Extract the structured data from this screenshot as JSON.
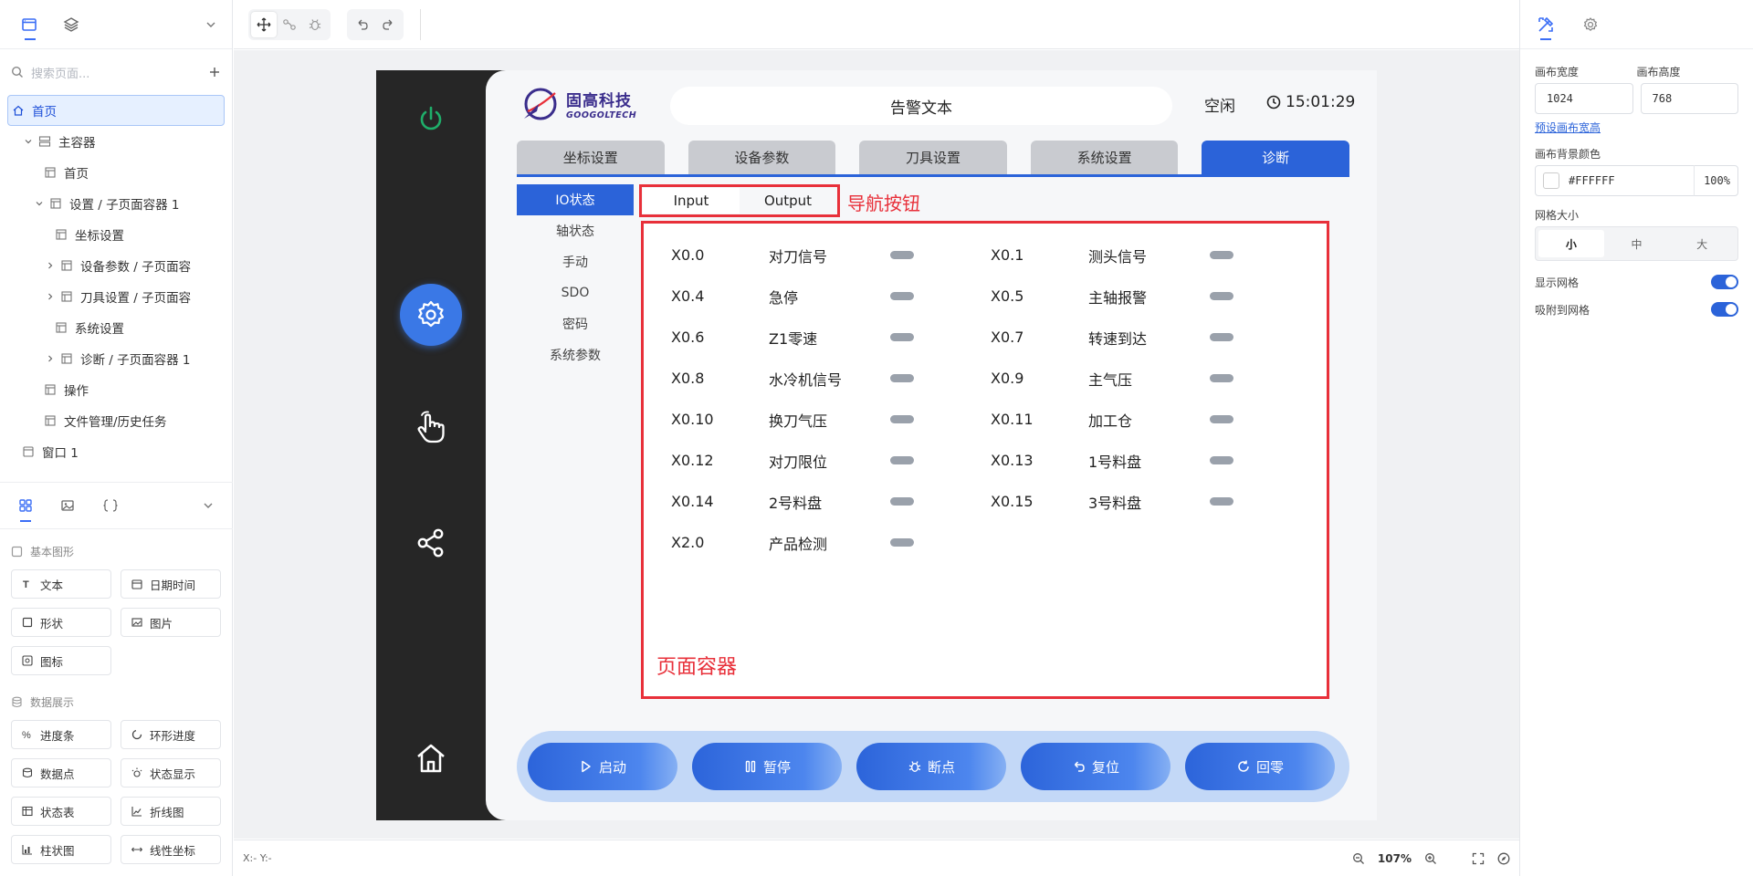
{
  "left_panel": {
    "search_placeholder": "搜索页面...",
    "tree": [
      {
        "label": "首页",
        "level": 0,
        "selected": true,
        "icon": "home-icon"
      },
      {
        "label": "主容器",
        "level": 1,
        "caret": "down",
        "icon": "container-icon"
      },
      {
        "label": "首页",
        "level": 2,
        "icon": "page-icon"
      },
      {
        "label": "设置 / 子页面容器 1",
        "level": 2,
        "caret": "down",
        "icon": "page-icon"
      },
      {
        "label": "坐标设置",
        "level": 3,
        "icon": "page-icon"
      },
      {
        "label": "设备参数 / 子页面容",
        "level": 3,
        "caret": "right",
        "icon": "page-icon"
      },
      {
        "label": "刀具设置 / 子页面容",
        "level": 3,
        "caret": "right",
        "icon": "page-icon"
      },
      {
        "label": "系统设置",
        "level": 3,
        "icon": "page-icon"
      },
      {
        "label": "诊断 / 子页面容器 1",
        "level": 3,
        "caret": "right",
        "icon": "page-icon"
      },
      {
        "label": "操作",
        "level": 2,
        "icon": "page-icon"
      },
      {
        "label": "文件管理/历史任务",
        "level": 2,
        "icon": "page-icon"
      },
      {
        "label": "窗口 1",
        "level": 0,
        "icon": "window-icon"
      }
    ],
    "basic_section": "基本图形",
    "basic_items": [
      "文本",
      "日期时间",
      "形状",
      "图片",
      "图标"
    ],
    "data_section": "数据展示",
    "data_items": [
      "进度条",
      "环形进度",
      "数据点",
      "状态显示",
      "状态表",
      "折线图",
      "柱状图",
      "线性坐标"
    ]
  },
  "statusbar": {
    "coords": "X:- Y:-",
    "zoom": "107%"
  },
  "hmi": {
    "logo_cn": "固高科技",
    "logo_en": "GOOGOLTECH",
    "alarm_text": "告警文本",
    "state": "空闲",
    "time": "15:01:29",
    "tabs": [
      "坐标设置",
      "设备参数",
      "刀具设置",
      "系统设置",
      "诊断"
    ],
    "active_tab": 4,
    "subnav": [
      "IO状态",
      "轴状态",
      "手动",
      "SDO",
      "密码",
      "系统参数"
    ],
    "nav_buttons": [
      "Input",
      "Output"
    ],
    "nav_annotation": "导航按钮",
    "container_annotation": "页面容器",
    "io_rows": [
      [
        {
          "addr": "X0.0",
          "name": "对刀信号"
        },
        {
          "addr": "X0.1",
          "name": "测头信号"
        }
      ],
      [
        {
          "addr": "X0.4",
          "name": "急停"
        },
        {
          "addr": "X0.5",
          "name": "主轴报警"
        }
      ],
      [
        {
          "addr": "X0.6",
          "name": "Z1零速"
        },
        {
          "addr": "X0.7",
          "name": "转速到达"
        }
      ],
      [
        {
          "addr": "X0.8",
          "name": "水冷机信号"
        },
        {
          "addr": "X0.9",
          "name": "主气压"
        }
      ],
      [
        {
          "addr": "X0.10",
          "name": "换刀气压"
        },
        {
          "addr": "X0.11",
          "name": "加工仓"
        }
      ],
      [
        {
          "addr": "X0.12",
          "name": "对刀限位"
        },
        {
          "addr": "X0.13",
          "name": "1号料盘"
        }
      ],
      [
        {
          "addr": "X0.14",
          "name": "2号料盘"
        },
        {
          "addr": "X0.15",
          "name": "3号料盘"
        }
      ],
      [
        {
          "addr": "X2.0",
          "name": "产品检测"
        }
      ]
    ],
    "actions": [
      {
        "label": "启动",
        "icon": "play-icon"
      },
      {
        "label": "暂停",
        "icon": "pause-icon"
      },
      {
        "label": "断点",
        "icon": "bug-icon"
      },
      {
        "label": "复位",
        "icon": "undo-icon"
      },
      {
        "label": "回零",
        "icon": "refresh-icon"
      }
    ]
  },
  "right_panel": {
    "width_label": "画布宽度",
    "height_label": "画布高度",
    "width_value": "1024",
    "height_value": "768",
    "preset_link": "预设画布宽高",
    "bg_label": "画布背景颜色",
    "bg_color": "#FFFFFF",
    "bg_opacity": "100",
    "bg_opacity_unit": "%",
    "grid_label": "网格大小",
    "grid_options": [
      "小",
      "中",
      "大"
    ],
    "grid_selected": 0,
    "show_grid_label": "显示网格",
    "snap_label": "吸附到网格"
  },
  "colors": {
    "accent": "#2b63d9",
    "annotation_red": "#e8303a",
    "hmi_dark": "#262626"
  }
}
